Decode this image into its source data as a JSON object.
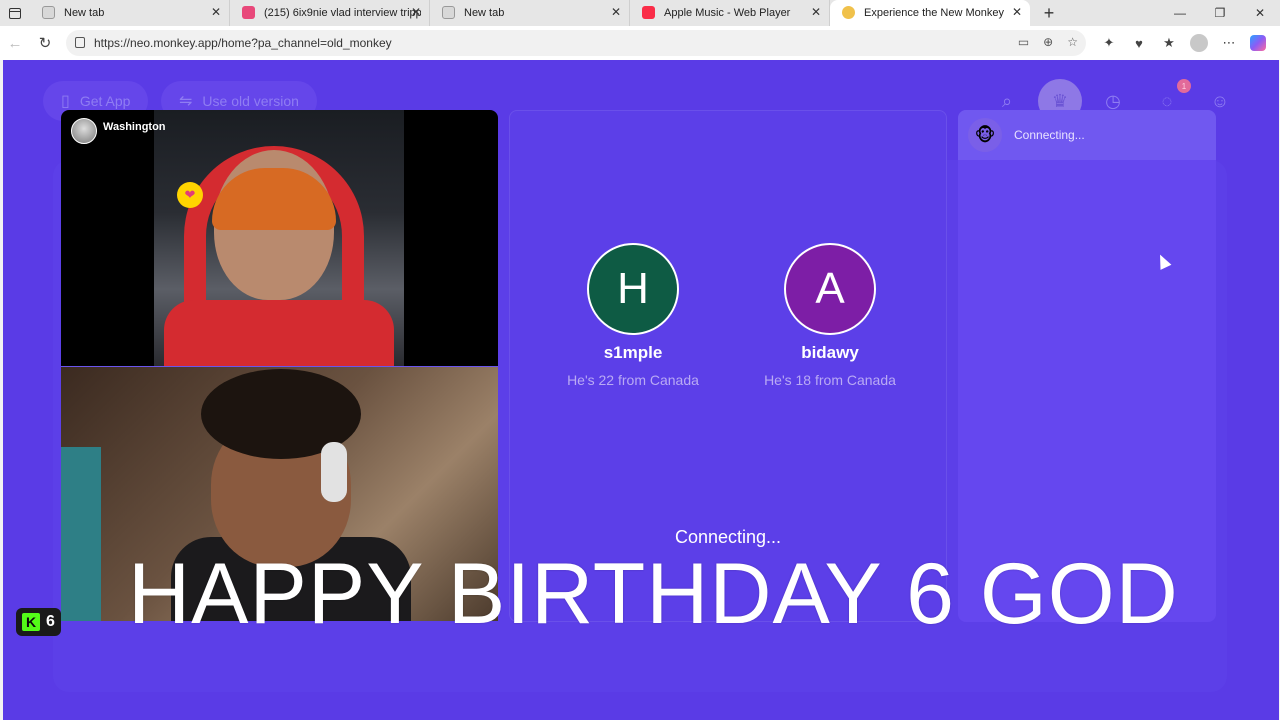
{
  "browser": {
    "tabs": [
      {
        "title": "New tab",
        "favicon_color": "#a0a0a0",
        "active": false
      },
      {
        "title": "(215) 6ix9nie vlad interview tripp",
        "favicon_color": "#e8487a",
        "active": false
      },
      {
        "title": "New tab",
        "favicon_color": "#a0a0a0",
        "active": false
      },
      {
        "title": "Apple Music - Web Player",
        "favicon_color": "#fa2d48",
        "active": false
      },
      {
        "title": "Experience the New Monkey",
        "favicon_color": "#f0c14b",
        "active": true
      }
    ],
    "url": "https://neo.monkey.app/home?pa_channel=old_monkey",
    "new_tab_symbol": "+"
  },
  "app": {
    "background_color": "#5a3be6",
    "nav": {
      "get_app_label": "Get App",
      "old_version_label": "Use old version",
      "notification_count": "1"
    },
    "remote_user": {
      "name": "Washington"
    },
    "suggestions": [
      {
        "initial": "H",
        "username": "s1mple",
        "subtitle": "He's 22 from Canada",
        "color": "#0e5b44"
      },
      {
        "initial": "A",
        "username": "bidawy",
        "subtitle": "He's 18 from Canada",
        "color": "#7d1ea6"
      }
    ],
    "status_text": "Connecting...",
    "chat": {
      "status_text": "Connecting..."
    }
  },
  "overlay": {
    "caption": "HAPPY BIRTHDAY 6 GOD",
    "kick_viewers": "6",
    "kick_logo": "K"
  }
}
